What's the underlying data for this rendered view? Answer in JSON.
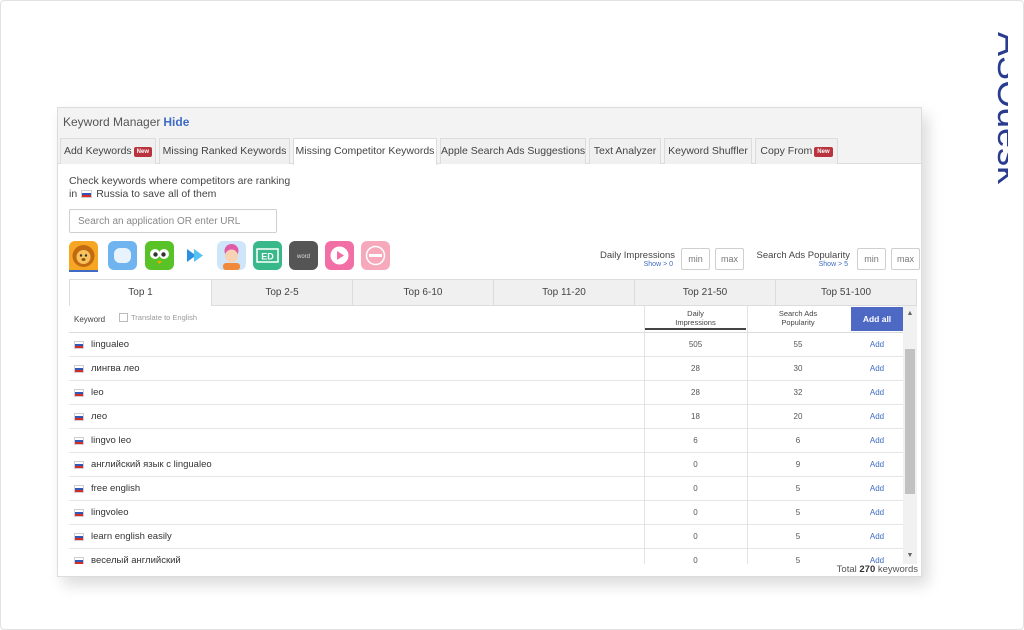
{
  "brand": {
    "name": "ASOdesk",
    "color": "#2a3c8f"
  },
  "panel": {
    "title": "Keyword Manager",
    "hide": "Hide"
  },
  "tabs": [
    {
      "label": "Add Keywords",
      "badge": "New"
    },
    {
      "label": "Missing Ranked Keywords",
      "badge": ""
    },
    {
      "label": "Missing Competitor Keywords",
      "badge": "",
      "active": true
    },
    {
      "label": "Apple Search Ads Suggestions",
      "badge": ""
    },
    {
      "label": "Text Analyzer",
      "badge": ""
    },
    {
      "label": "Keyword Shuffler",
      "badge": ""
    },
    {
      "label": "Copy From",
      "badge": "New"
    }
  ],
  "help": {
    "line1": "Check keywords where competitors are ranking",
    "in": "in",
    "country": "Russia",
    "line2_rest": "to save all of them"
  },
  "search": {
    "placeholder": "Search an application OR enter URL",
    "value": ""
  },
  "app_icons": [
    "lion-app-icon",
    "blue-bubble-app-icon",
    "owl-app-icon",
    "play-arrows-app-icon",
    "girl-app-icon",
    "ed-app-icon",
    "word-app-icon",
    "pink-play-app-icon",
    "pink-badge-app-icon"
  ],
  "filters": {
    "daily": {
      "label": "Daily Impressions",
      "sub": "Show > 0",
      "min": "min",
      "max": "max"
    },
    "popularity": {
      "label": "Search Ads Popularity",
      "sub": "Show > 5",
      "min": "min",
      "max": "max"
    }
  },
  "rank_tabs": [
    "Top 1",
    "Top 2-5",
    "Top 6-10",
    "Top 11-20",
    "Top 21-50",
    "Top 51-100"
  ],
  "table": {
    "col_keyword": "Keyword",
    "translate": "Translate to English",
    "col_daily": [
      "Daily",
      "Impressions"
    ],
    "col_popularity": [
      "Search Ads",
      "Popularity"
    ],
    "add_all": "Add all",
    "rows": [
      {
        "keyword": "lingualeo",
        "daily": "505",
        "popularity": "55",
        "action": "Add"
      },
      {
        "keyword": "лингва лео",
        "daily": "28",
        "popularity": "30",
        "action": "Add"
      },
      {
        "keyword": "leo",
        "daily": "28",
        "popularity": "32",
        "action": "Add"
      },
      {
        "keyword": "лео",
        "daily": "18",
        "popularity": "20",
        "action": "Add"
      },
      {
        "keyword": "lingvo leo",
        "daily": "6",
        "popularity": "6",
        "action": "Add"
      },
      {
        "keyword": "английский язык с lingualeo",
        "daily": "0",
        "popularity": "9",
        "action": "Add"
      },
      {
        "keyword": "free english",
        "daily": "0",
        "popularity": "5",
        "action": "Add"
      },
      {
        "keyword": "lingvoleo",
        "daily": "0",
        "popularity": "5",
        "action": "Add"
      },
      {
        "keyword": "learn english easily",
        "daily": "0",
        "popularity": "5",
        "action": "Add"
      },
      {
        "keyword": "веселый английский",
        "daily": "0",
        "popularity": "5",
        "action": "Add"
      }
    ]
  },
  "total": {
    "prefix": "Total",
    "count": "270",
    "suffix": "keywords"
  },
  "colors": {
    "accent": "#3f6bc4",
    "button": "#4e69c4",
    "badge": "#b8333d"
  }
}
